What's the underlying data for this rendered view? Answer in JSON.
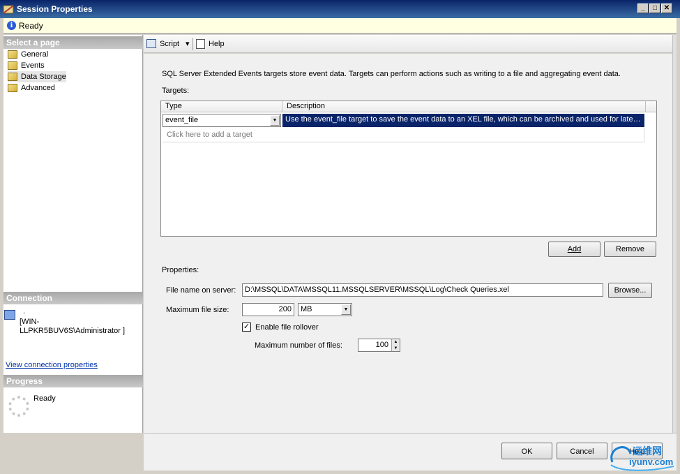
{
  "window": {
    "title": "Session Properties",
    "minimize": "_",
    "maximize": "□",
    "close": "✕"
  },
  "status": {
    "text": "Ready"
  },
  "left": {
    "select_header": "Select a page",
    "pages": [
      {
        "label": "General"
      },
      {
        "label": "Events"
      },
      {
        "label": "Data Storage"
      },
      {
        "label": "Advanced"
      }
    ],
    "connection_header": "Connection",
    "connection_dot": ".",
    "connection_user": "[WIN-LLPKR5BUV6S\\Administrator ]",
    "connection_link": "View connection properties",
    "progress_header": "Progress",
    "progress_status": "Ready"
  },
  "toolbar": {
    "script_label": "Script",
    "script_arrow": "▾",
    "help_label": "Help"
  },
  "main": {
    "intro": "SQL Server Extended Events targets store event data. Targets can perform actions such as writing to a file and aggregating event data.",
    "targets_label": "Targets:",
    "grid": {
      "col_type": "Type",
      "col_description": "Description",
      "type_value": "event_file",
      "description_value": "Use the event_file target to save the event data to an XEL file, which can be archived and used for later analysis and review. You can merge multiple XEL files to view the combined data from separate event sessions.",
      "add_row": "Click here to add a target"
    },
    "add_label": "Add",
    "remove_label": "Remove",
    "properties_label": "Properties:",
    "file_name_label": "File name on server:",
    "file_name_value": "D:\\MSSQL\\DATA\\MSSQL11.MSSQLSERVER\\MSSQL\\Log\\Check Queries.xel",
    "browse_label": "Browse...",
    "max_size_label": "Maximum file size:",
    "max_size_value": "200",
    "max_size_unit": "MB",
    "rollover_label": "Enable file rollover",
    "rollover_checked": "✓",
    "max_files_label": "Maximum number of files:",
    "max_files_value": "100"
  },
  "buttons": {
    "ok": "OK",
    "cancel": "Cancel",
    "help": "Help"
  },
  "watermark": {
    "cn": "运维网",
    "en": "iyunv.com"
  }
}
